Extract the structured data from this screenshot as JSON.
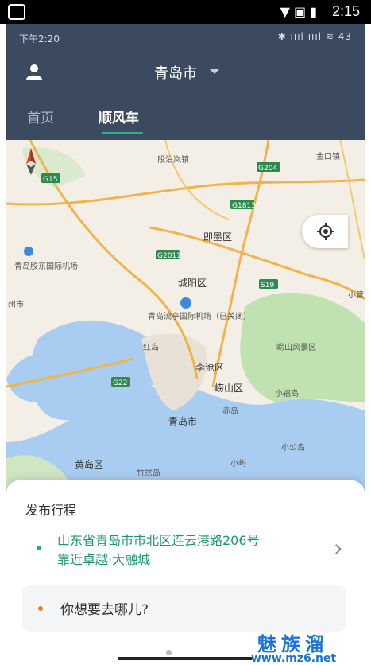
{
  "outer_status": {
    "time": "2:15"
  },
  "inner_status": {
    "time": "下午2:20",
    "right": "✱ ıııl ıııl ≋ 43"
  },
  "header": {
    "city": "青岛市",
    "tabs": [
      {
        "label": "首页"
      },
      {
        "label": "顺风车"
      }
    ]
  },
  "map": {
    "labels": [
      "段泊岚镇",
      "金口镇",
      "即墨区",
      "青岛胶东国际机场",
      "城阳区",
      "青岛流亭国际机场（已关闭）",
      "红岛",
      "崂山风景区",
      "李沧区",
      "崂山区",
      "小福岛",
      "赤岛",
      "青岛市",
      "小公岛",
      "黄岛区",
      "竹岔岛",
      "小屿",
      "小管",
      "州市"
    ],
    "road_labels": [
      "G15",
      "G204",
      "G1813",
      "G2011",
      "S19",
      "G22"
    ]
  },
  "panel": {
    "title": "发布行程",
    "from_line1": "山东省青岛市市北区连云港路206号",
    "from_line2": "靠近卓越·大融城",
    "to_placeholder": "你想要去哪儿?"
  },
  "watermark": {
    "title": "魅族溜",
    "url": "www.mz6.net"
  },
  "colors": {
    "header_bg": "#3c4a5f",
    "accent_green": "#29b583",
    "origin_dot": "#1bb18a",
    "dest_dot": "#f07a24"
  }
}
